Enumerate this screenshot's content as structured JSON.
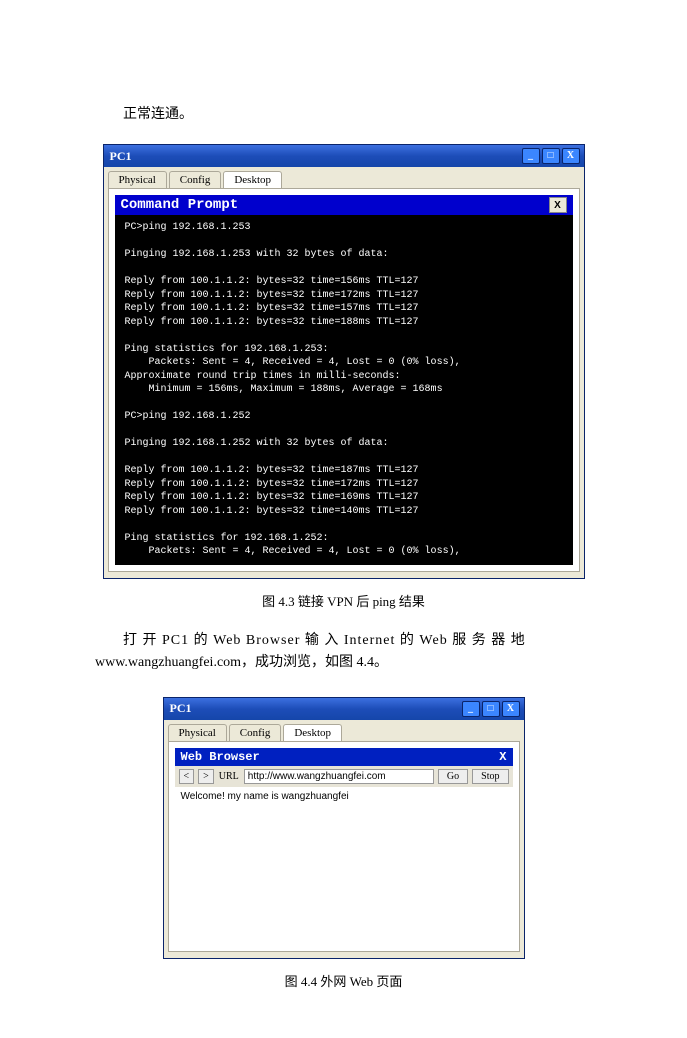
{
  "intro_text": "正常连通。",
  "fig1": {
    "window_title": "PC1",
    "tabs": [
      "Physical",
      "Config",
      "Desktop"
    ],
    "tab_active_index": 2,
    "panel_title": "Command Prompt",
    "close_label": "X",
    "terminal_text": "PC>ping 192.168.1.253\n\nPinging 192.168.1.253 with 32 bytes of data:\n\nReply from 100.1.1.2: bytes=32 time=156ms TTL=127\nReply from 100.1.1.2: bytes=32 time=172ms TTL=127\nReply from 100.1.1.2: bytes=32 time=157ms TTL=127\nReply from 100.1.1.2: bytes=32 time=188ms TTL=127\n\nPing statistics for 192.168.1.253:\n    Packets: Sent = 4, Received = 4, Lost = 0 (0% loss),\nApproximate round trip times in milli-seconds:\n    Minimum = 156ms, Maximum = 188ms, Average = 168ms\n\nPC>ping 192.168.1.252\n\nPinging 192.168.1.252 with 32 bytes of data:\n\nReply from 100.1.1.2: bytes=32 time=187ms TTL=127\nReply from 100.1.1.2: bytes=32 time=172ms TTL=127\nReply from 100.1.1.2: bytes=32 time=169ms TTL=127\nReply from 100.1.1.2: bytes=32 time=140ms TTL=127\n\nPing statistics for 192.168.1.252:\n    Packets: Sent = 4, Received = 4, Lost = 0 (0% loss),",
    "caption": "图 4.3  链接 VPN 后 ping 结果"
  },
  "mid_text_line1": "打 开 PC1 的 Web Browser 输 入 Internet 的 Web 服 务 器 地",
  "mid_text_line2": "www.wangzhuangfei.com，成功浏览，如图 4.4。",
  "fig2": {
    "window_title": "PC1",
    "tabs": [
      "Physical",
      "Config",
      "Desktop"
    ],
    "tab_active_index": 2,
    "panel_title": "Web Browser",
    "close_label": "X",
    "nav_back": "<",
    "nav_fwd": ">",
    "url_label": "URL",
    "url_value": "http://www.wangzhuangfei.com",
    "go_label": "Go",
    "stop_label": "Stop",
    "page_text": "Welcome! my name is wangzhuangfei",
    "caption": "图 4.4  外网 Web 页面"
  },
  "titlebar_icons": {
    "min": "_",
    "max": "□",
    "close": "X"
  }
}
